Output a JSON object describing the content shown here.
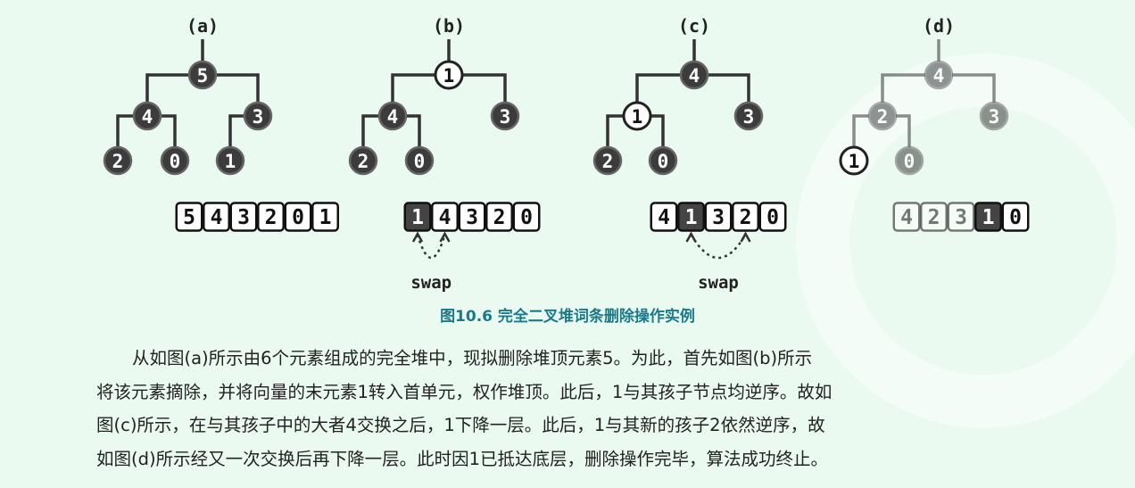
{
  "panels": [
    {
      "label": "(a)",
      "nodes": [
        "5",
        "4",
        "3",
        "2",
        "0",
        "1"
      ],
      "dark": [
        true,
        true,
        true,
        true,
        true,
        true
      ],
      "faded": [
        false,
        false,
        false,
        false,
        false,
        false
      ],
      "array": [
        "5",
        "4",
        "3",
        "2",
        "0",
        "1"
      ],
      "array_dark": [
        false,
        false,
        false,
        false,
        false,
        false
      ],
      "array_faded": [
        false,
        false,
        false,
        false,
        false,
        false
      ]
    },
    {
      "label": "(b)",
      "nodes": [
        "1",
        "4",
        "3",
        "2",
        "0"
      ],
      "dark": [
        false,
        true,
        true,
        true,
        true
      ],
      "faded": [
        false,
        false,
        false,
        false,
        false
      ],
      "array": [
        "1",
        "4",
        "3",
        "2",
        "0"
      ],
      "array_dark": [
        true,
        false,
        false,
        false,
        false
      ],
      "array_faded": [
        false,
        false,
        false,
        false,
        false
      ],
      "swap_label": "swap"
    },
    {
      "label": "(c)",
      "nodes": [
        "4",
        "1",
        "3",
        "2",
        "0"
      ],
      "dark": [
        true,
        false,
        true,
        true,
        true
      ],
      "faded": [
        false,
        false,
        false,
        false,
        false
      ],
      "array": [
        "4",
        "1",
        "3",
        "2",
        "0"
      ],
      "array_dark": [
        false,
        true,
        false,
        false,
        false
      ],
      "array_faded": [
        false,
        false,
        false,
        false,
        false
      ],
      "swap_label": "swap"
    },
    {
      "label": "(d)",
      "nodes": [
        "4",
        "2",
        "3",
        "1",
        "0"
      ],
      "dark": [
        true,
        true,
        true,
        false,
        true
      ],
      "faded": [
        true,
        true,
        true,
        false,
        true
      ],
      "array": [
        "4",
        "2",
        "3",
        "1",
        "0"
      ],
      "array_dark": [
        false,
        false,
        false,
        true,
        false
      ],
      "array_faded": [
        true,
        true,
        true,
        false,
        false
      ]
    }
  ],
  "caption": "图10.6  完全二叉堆词条删除操作实例",
  "body": [
    "从如图(a)所示由6个元素组成的完全堆中，现拟删除堆顶元素5。为此，首先如图(b)所示",
    "将该元素摘除，并将向量的末元素1转入首单元，权作堆顶。此后，1与其孩子节点均逆序。故如",
    "图(c)所示，在与其孩子中的大者4交换之后，1下降一层。此后，1与其新的孩子2依然逆序，故",
    "如图(d)所示经又一次交换后再下降一层。此时因1已抵达底层，删除操作完毕，算法成功终止。"
  ]
}
